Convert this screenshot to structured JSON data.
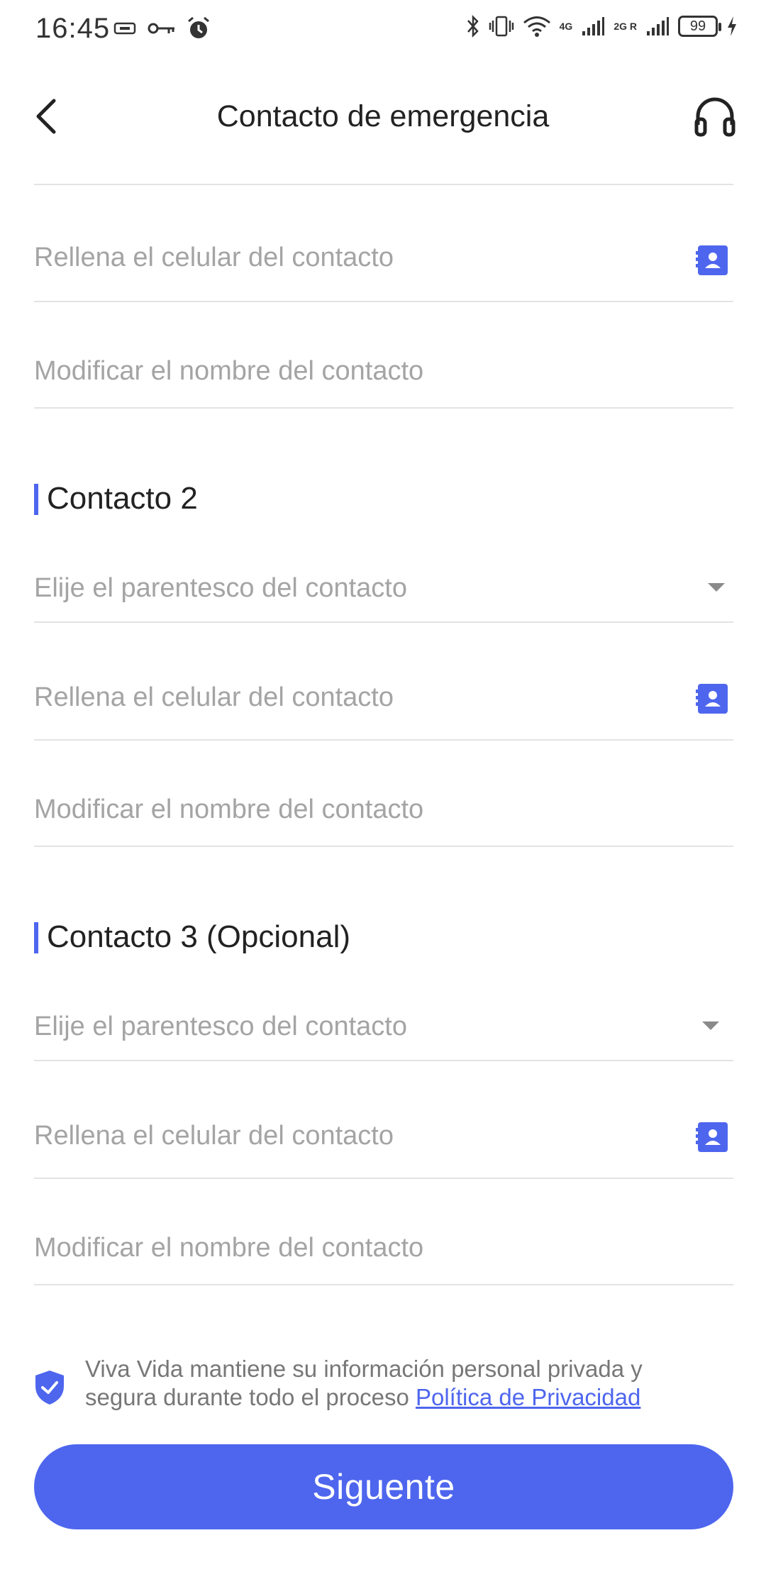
{
  "status_bar": {
    "time": "16:45",
    "network_1": "4G",
    "network_2": "2G R",
    "battery": "99",
    "icons": [
      "usb-icon",
      "key-icon",
      "alarm-icon",
      "bluetooth-icon",
      "vibrate-icon",
      "wifi-icon",
      "signal-icon",
      "signal-icon",
      "charging-icon"
    ]
  },
  "header": {
    "title": "Contacto de emergencia",
    "back_icon": "back-arrow-icon",
    "support_icon": "headset-icon"
  },
  "contact1": {
    "phone_placeholder": "Rellena el celular del contacto",
    "name_placeholder": "Modificar el nombre del contacto"
  },
  "contact2": {
    "title": "Contacto 2",
    "relation_placeholder": "Elije el parentesco del contacto",
    "phone_placeholder": "Rellena el celular del contacto",
    "name_placeholder": "Modificar el nombre del contacto"
  },
  "contact3": {
    "title": "Contacto 3 (Opcional)",
    "relation_placeholder": "Elije el parentesco del contacto",
    "phone_placeholder": "Rellena el celular del contacto",
    "name_placeholder": "Modificar el nombre del contacto"
  },
  "privacy": {
    "line1": "Viva Vida mantiene su información personal privada y",
    "line2": "segura durante todo el proceso ",
    "link": "Política de Privacidad"
  },
  "next_button": "Siguente",
  "colors": {
    "accent": "#4e66ee",
    "placeholder": "#a4a4a4",
    "divider": "#e3e3e3"
  }
}
